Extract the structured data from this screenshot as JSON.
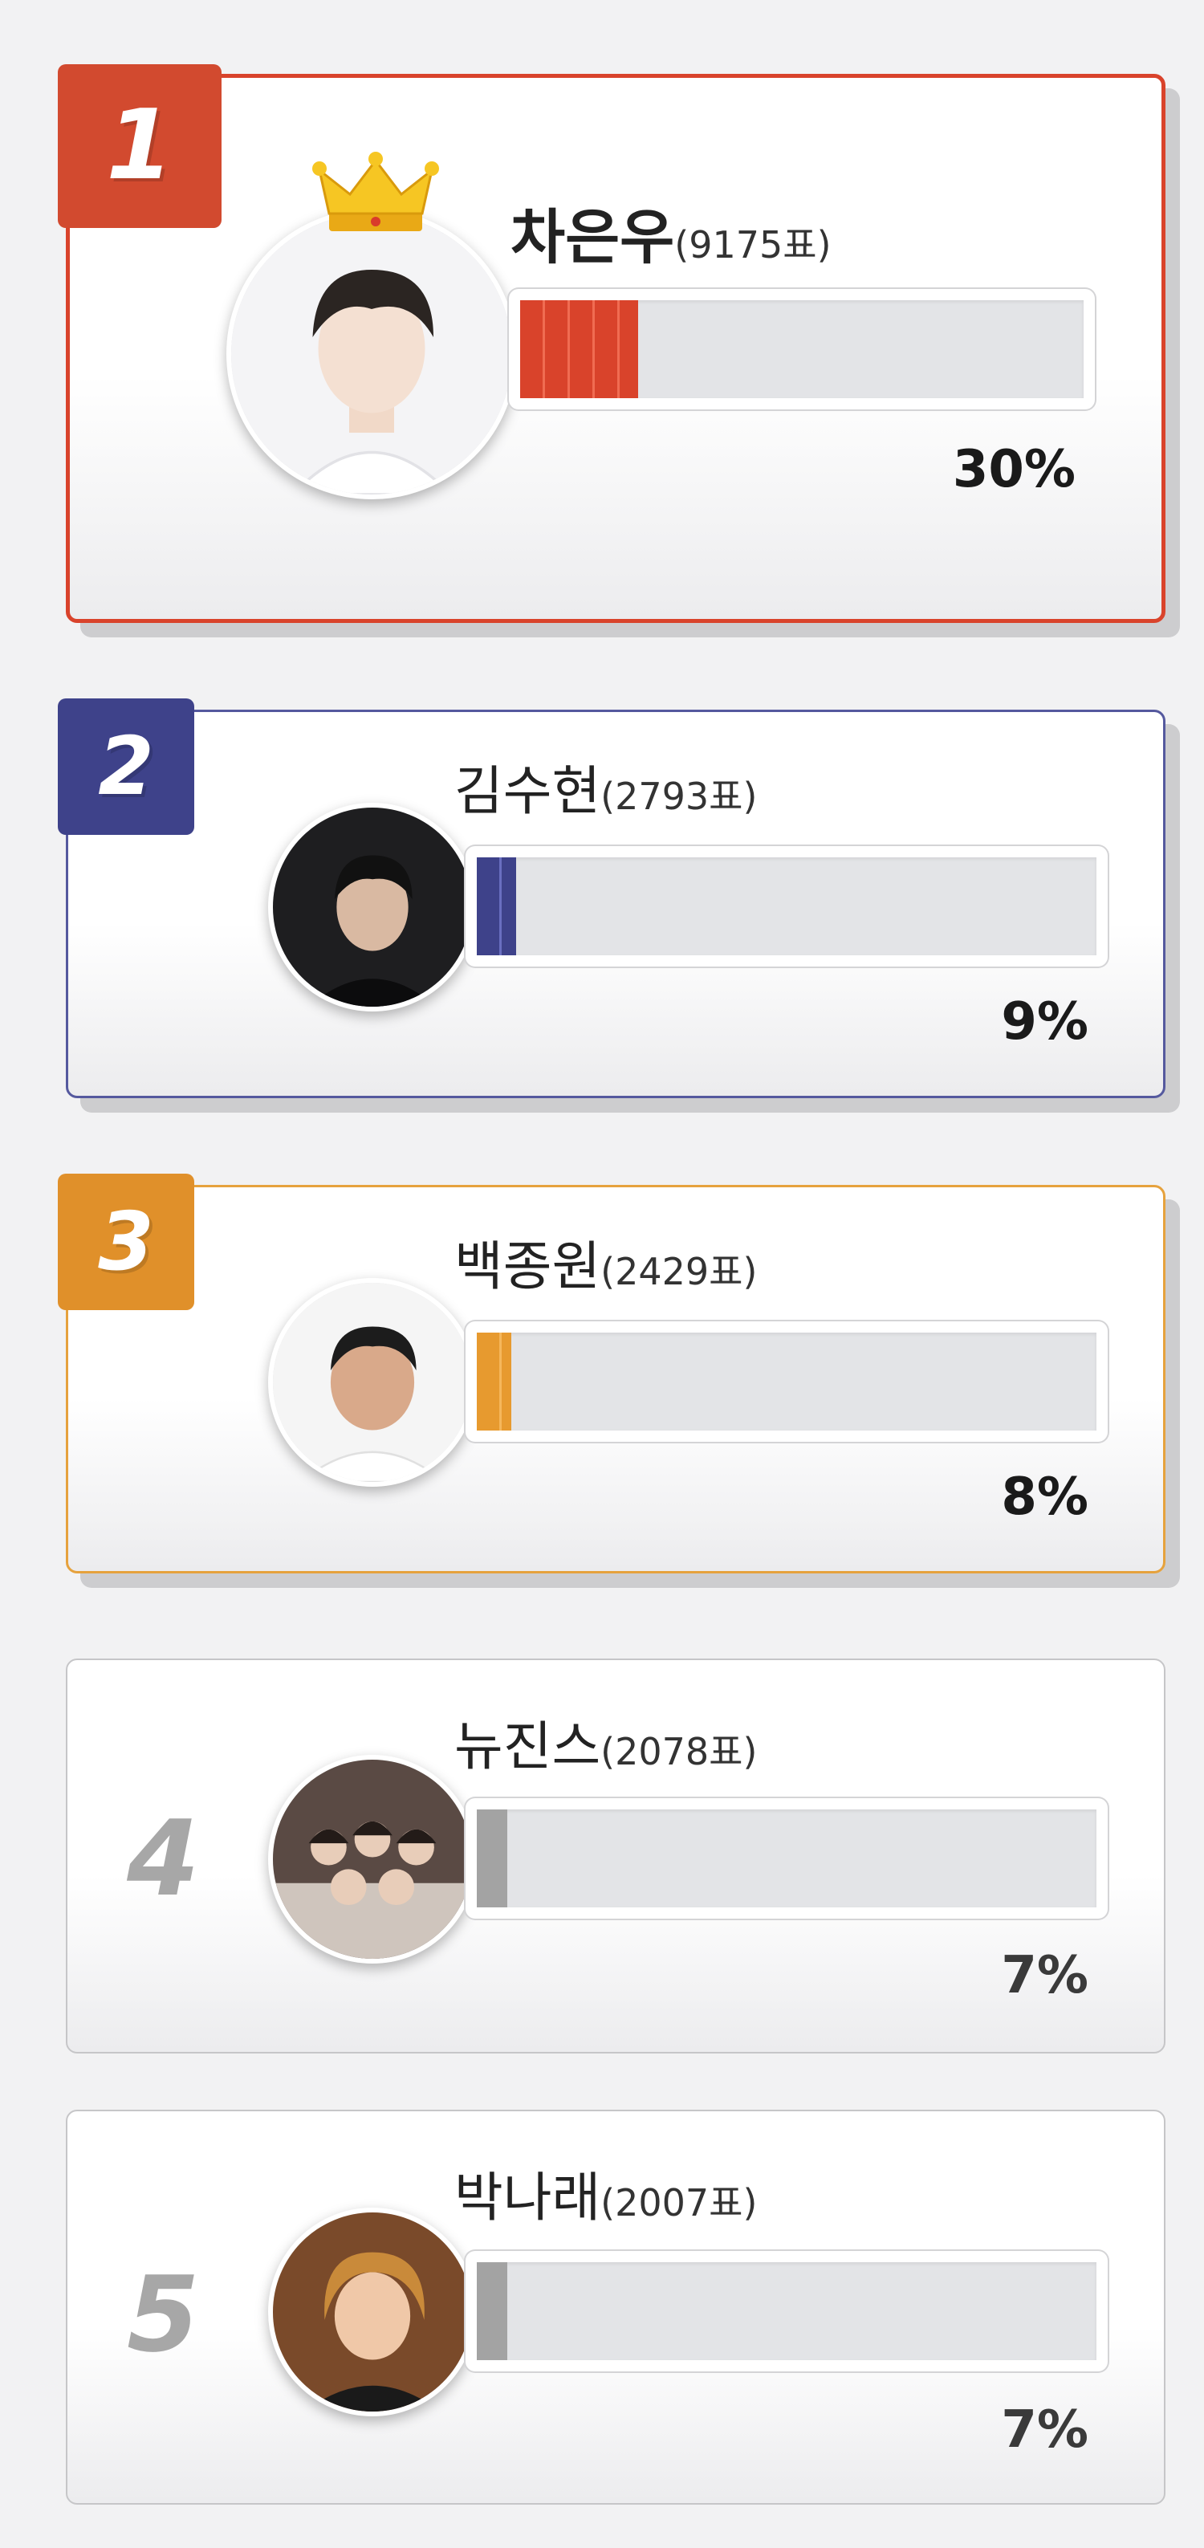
{
  "entries": [
    {
      "rank": "1",
      "name": "차은우",
      "votes": "(9175표)",
      "percent_label": "30%",
      "percent": 30,
      "color": "#d9432b",
      "border": "#d9432b"
    },
    {
      "rank": "2",
      "name": "김수현",
      "votes": "(2793표)",
      "percent_label": "9%",
      "percent": 9,
      "color": "#3e428a",
      "border": "#55599e"
    },
    {
      "rank": "3",
      "name": "백종원",
      "votes": "(2429표)",
      "percent_label": "8%",
      "percent": 8,
      "color": "#e79a2f",
      "border": "#e6a23d"
    },
    {
      "rank": "4",
      "name": "뉴진스",
      "votes": "(2078표)",
      "percent_label": "7%",
      "percent": 7,
      "color": "#a3a3a3",
      "border": "#c6c6c8"
    },
    {
      "rank": "5",
      "name": "박나래",
      "votes": "(2007표)",
      "percent_label": "7%",
      "percent": 7,
      "color": "#a3a3a3",
      "border": "#c6c6c8"
    }
  ],
  "icons": {
    "crown": "crown-icon"
  }
}
